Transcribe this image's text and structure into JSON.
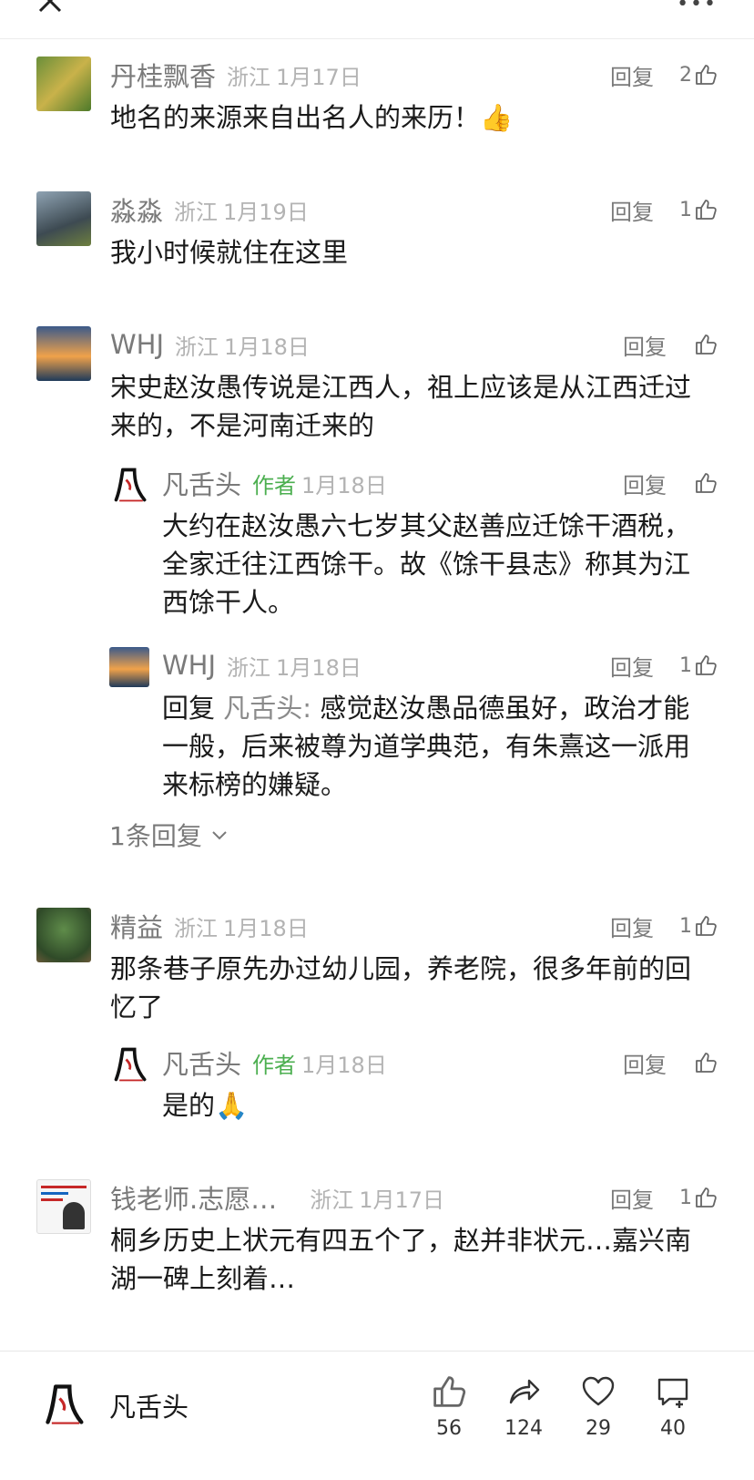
{
  "header": {
    "close_icon": "close-icon",
    "more_icon": "more-icon"
  },
  "comments": [
    {
      "name": "丹桂飘香",
      "location": "浙江",
      "date": "1月17日",
      "reply_label": "回复",
      "likes": "2",
      "text": "地名的来源来自出名人的来历！",
      "emoji": "👍"
    },
    {
      "name": "淼淼",
      "location": "浙江",
      "date": "1月19日",
      "reply_label": "回复",
      "likes": "1",
      "text": "我小时候就住在这里"
    },
    {
      "name": "WHJ",
      "location": "浙江",
      "date": "1月18日",
      "reply_label": "回复",
      "likes": "",
      "text": "宋史赵汝愚传说是江西人，祖上应该是从江西迁过来的，不是河南迁来的"
    },
    {
      "name": "凡舌头",
      "author_tag": "作者",
      "date": "1月18日",
      "reply_label": "回复",
      "likes": "",
      "text": "大约在赵汝愚六七岁其父赵善应迁馀干酒税，全家迁往江西馀干。故《馀干县志》称其为江西馀干人。"
    },
    {
      "name": "WHJ",
      "location": "浙江",
      "date": "1月18日",
      "reply_label": "回复",
      "likes": "1",
      "reply_prefix": "回复 ",
      "reply_to": "凡舌头:",
      "text": " 感觉赵汝愚品德虽好，政治才能一般，后来被尊为道学典范，有朱熹这一派用来标榜的嫌疑。"
    },
    {
      "name": "精益",
      "location": "浙江",
      "date": "1月18日",
      "reply_label": "回复",
      "likes": "1",
      "text": "那条巷子原先办过幼儿园，养老院，很多年前的回忆了"
    },
    {
      "name": "凡舌头",
      "author_tag": "作者",
      "date": "1月18日",
      "reply_label": "回复",
      "likes": "",
      "text": "是的",
      "emoji": "🙏"
    },
    {
      "name": "钱老师.志愿…",
      "location": "浙江",
      "date": "1月17日",
      "reply_label": "回复",
      "likes": "1",
      "text": "桐乡历史上状元有四五个了，赵并非状元…嘉兴南湖一碑上刻着…"
    }
  ],
  "more_replies": "1条回复",
  "bottom_bar": {
    "author": "凡舌头",
    "like_count": "56",
    "share_count": "124",
    "fav_count": "29",
    "comment_count": "40"
  },
  "colors": {
    "author_tag": "#4caf50",
    "meta_gray": "#b3b3b3",
    "name_gray": "#7a7a7a"
  }
}
